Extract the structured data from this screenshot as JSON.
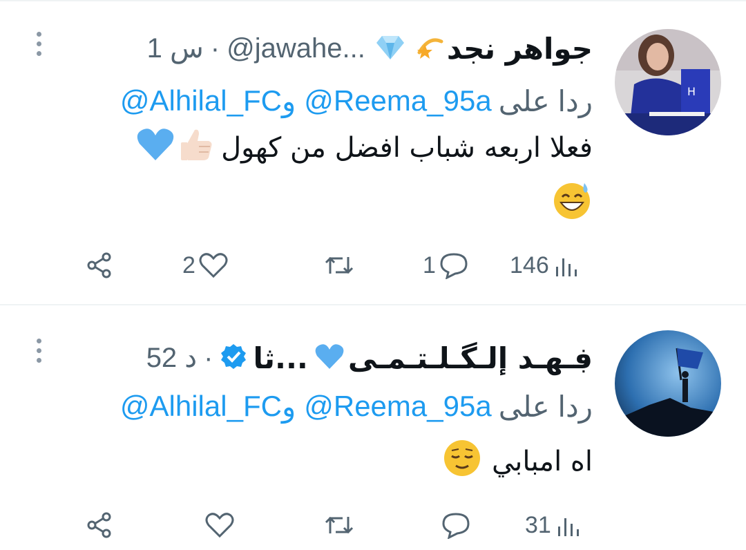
{
  "tweets": [
    {
      "name": "جواهر نجد",
      "name_emojis": [
        "sparkle-star-icon",
        "gem-icon"
      ],
      "handle": "@jawahe...",
      "separator": "·",
      "time": "1 س",
      "reply_prefix": "ردا على",
      "mention_1": "@Reema_95a",
      "connector": "و",
      "mention_2": "@Alhilal_FC",
      "text_line_1": "فعلا اربعه شباب افضل من كهول",
      "text_line_1_emojis": [
        "thumbs-up-icon",
        "blue-heart-icon"
      ],
      "text_line_2_emojis": [
        "grinning-sweat-face-icon"
      ],
      "likes": "2",
      "replies": "1",
      "views": "146",
      "retweets": ""
    },
    {
      "name": "ڣـهـد إلـگـلـتـمـی",
      "name_suffix": "ثا...",
      "name_emojis": [
        "blue-heart-icon",
        "verified-badge-icon"
      ],
      "separator": "·",
      "time": "52 د",
      "reply_prefix": "ردا على",
      "mention_1": "@Reema_95a",
      "connector": "و",
      "mention_2": "@Alhilal_FC",
      "text_line_1": "اه امبابي",
      "text_line_1_emojis": [
        "relieved-face-icon"
      ],
      "likes": "",
      "replies": "",
      "views": "31",
      "retweets": ""
    }
  ],
  "colors": {
    "link": "#1d9bf0",
    "secondary_text": "#536471",
    "primary_text": "#0f1419",
    "divider": "#eff3f4"
  }
}
